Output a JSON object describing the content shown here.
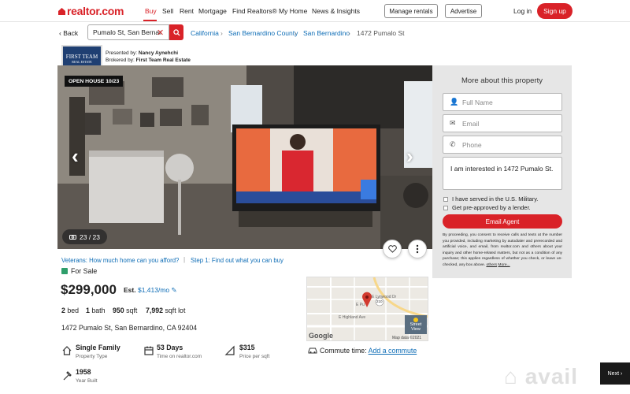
{
  "header": {
    "logo_text": "realtor.com",
    "nav": [
      "Buy",
      "Sell",
      "Rent",
      "Mortgage",
      "Find Realtors®",
      "My Home",
      "News & Insights"
    ],
    "manage_rentals": "Manage rentals",
    "advertise": "Advertise",
    "login": "Log in",
    "signup": "Sign up",
    "accent": "#d92228"
  },
  "search": {
    "back": "Back",
    "value": "Pumalo St, San Bernar",
    "breadcrumbs": [
      "California",
      "San Bernardino County",
      "San Bernardino",
      "1472 Pumalo St"
    ]
  },
  "broker": {
    "logo_line1": "FIRST TEAM",
    "logo_line2": "REAL ESTATE",
    "presented_label": "Presented by:",
    "presented_name": "Nancy Aynehchi",
    "brokered_label": "Brokered by:",
    "brokered_name": "First Team Real Estate"
  },
  "photo": {
    "badge": "OPEN HOUSE 10/23",
    "counter": "23 / 23"
  },
  "form": {
    "title": "More about this property",
    "full_name_placeholder": "Full Name",
    "email_placeholder": "Email",
    "phone_placeholder": "Phone",
    "message": "I am interested in 1472 Pumalo St.",
    "check_veteran": "I have served in the U.S. Military.",
    "check_preapproved": "Get pre-approved by a lender.",
    "submit": "Email Agent",
    "disclaimer": "By proceeding, you consent to receive calls and texts at the number you provided, including marketing by autodialer and prerecorded and artificial voice, and email, from realtor.com and others about your inquiry and other home-related matters, but not as a condition of any purchase; this applies regardless of whether you check, or leave un-checked, any box above.",
    "disclaimer_others": "others",
    "disclaimer_more": "More..."
  },
  "listing": {
    "veterans_link": "Veterans: How much home can you afford?",
    "step_link": "Step 1: Find out what you can buy",
    "status": "For Sale",
    "status_color": "#2f9e6b",
    "price": "$299,000",
    "est_label": "Est.",
    "est_amount": "$1,413/mo",
    "beds": "2",
    "beds_label": "bed",
    "baths": "1",
    "baths_label": "bath",
    "sqft": "950",
    "sqft_label": "sqft",
    "lot": "7,992",
    "lot_label": "sqft lot",
    "address": "1472 Pumalo St, San Bernardino, CA 92404",
    "features": [
      {
        "title": "Single Family",
        "sub": "Property Type",
        "icon": "house-icon"
      },
      {
        "title": "53 Days",
        "sub": "Time on realtor.com",
        "icon": "calendar-icon"
      },
      {
        "title": "$315",
        "sub": "Price per sqft",
        "icon": "ruler-icon"
      },
      {
        "title": "1958",
        "sub": "Year Built",
        "icon": "hammer-icon"
      }
    ]
  },
  "map": {
    "street_view": "Street View",
    "google": "Google",
    "map_data": "Map data ©2021",
    "label_lynwood": "E Lynwood Dr",
    "label_highland": "E Highland Ave",
    "label_pumalo": "E Pu",
    "route": "210"
  },
  "commute": {
    "label": "Commute time:",
    "link": "Add a commute"
  },
  "next": "Next"
}
